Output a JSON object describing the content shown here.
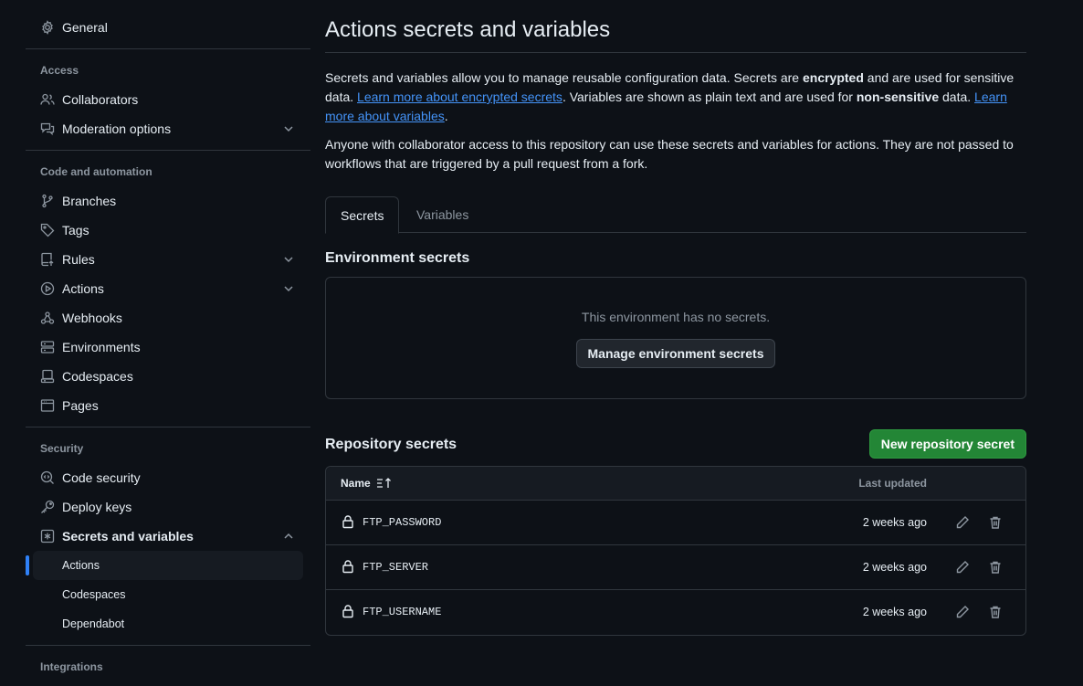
{
  "sidebar": {
    "top_item": {
      "label": "General",
      "icon": "gear-icon"
    },
    "sections": [
      {
        "title": "Access",
        "items": [
          {
            "label": "Collaborators",
            "icon": "people-icon"
          },
          {
            "label": "Moderation options",
            "icon": "comment-discussion-icon",
            "expandable": true
          }
        ]
      },
      {
        "title": "Code and automation",
        "items": [
          {
            "label": "Branches",
            "icon": "git-branch-icon"
          },
          {
            "label": "Tags",
            "icon": "tag-icon"
          },
          {
            "label": "Rules",
            "icon": "repo-push-icon",
            "expandable": true
          },
          {
            "label": "Actions",
            "icon": "play-icon",
            "expandable": true
          },
          {
            "label": "Webhooks",
            "icon": "webhook-icon"
          },
          {
            "label": "Environments",
            "icon": "server-icon"
          },
          {
            "label": "Codespaces",
            "icon": "codespaces-icon"
          },
          {
            "label": "Pages",
            "icon": "browser-icon"
          }
        ]
      },
      {
        "title": "Security",
        "items": [
          {
            "label": "Code security",
            "icon": "codescan-icon"
          },
          {
            "label": "Deploy keys",
            "icon": "key-icon"
          },
          {
            "label": "Secrets and variables",
            "icon": "key-asterisk-icon",
            "expanded": true
          }
        ],
        "subitems": [
          {
            "label": "Actions",
            "active": true
          },
          {
            "label": "Codespaces"
          },
          {
            "label": "Dependabot"
          }
        ]
      },
      {
        "title": "Integrations",
        "items": []
      }
    ]
  },
  "main": {
    "title": "Actions secrets and variables",
    "intro": {
      "p1_a": "Secrets and variables allow you to manage reusable configuration data. Secrets are ",
      "p1_b": "encrypted",
      "p1_c": " and are used for sensitive data. ",
      "p1_link1": "Learn more about encrypted secrets",
      "p1_d": ". Variables are shown as plain text and are used for ",
      "p1_e": "non-sensitive",
      "p1_f": " data. ",
      "p1_link2": "Learn more about variables",
      "p1_g": ".",
      "p2": "Anyone with collaborator access to this repository can use these secrets and variables for actions. They are not passed to workflows that are triggered by a pull request from a fork."
    },
    "tabs": [
      {
        "label": "Secrets",
        "active": true
      },
      {
        "label": "Variables",
        "active": false
      }
    ],
    "env": {
      "title": "Environment secrets",
      "empty_text": "This environment has no secrets.",
      "button": "Manage environment secrets"
    },
    "repo": {
      "title": "Repository secrets",
      "new_button": "New repository secret",
      "columns": {
        "name": "Name",
        "updated": "Last updated"
      },
      "rows": [
        {
          "name": "FTP_PASSWORD",
          "updated": "2 weeks ago"
        },
        {
          "name": "FTP_SERVER",
          "updated": "2 weeks ago"
        },
        {
          "name": "FTP_USERNAME",
          "updated": "2 weeks ago"
        }
      ]
    }
  },
  "colors": {
    "background": "#0d1117",
    "accent": "#2f81f7",
    "link": "#4493f8",
    "primary_button": "#238636",
    "border": "#30363d"
  }
}
